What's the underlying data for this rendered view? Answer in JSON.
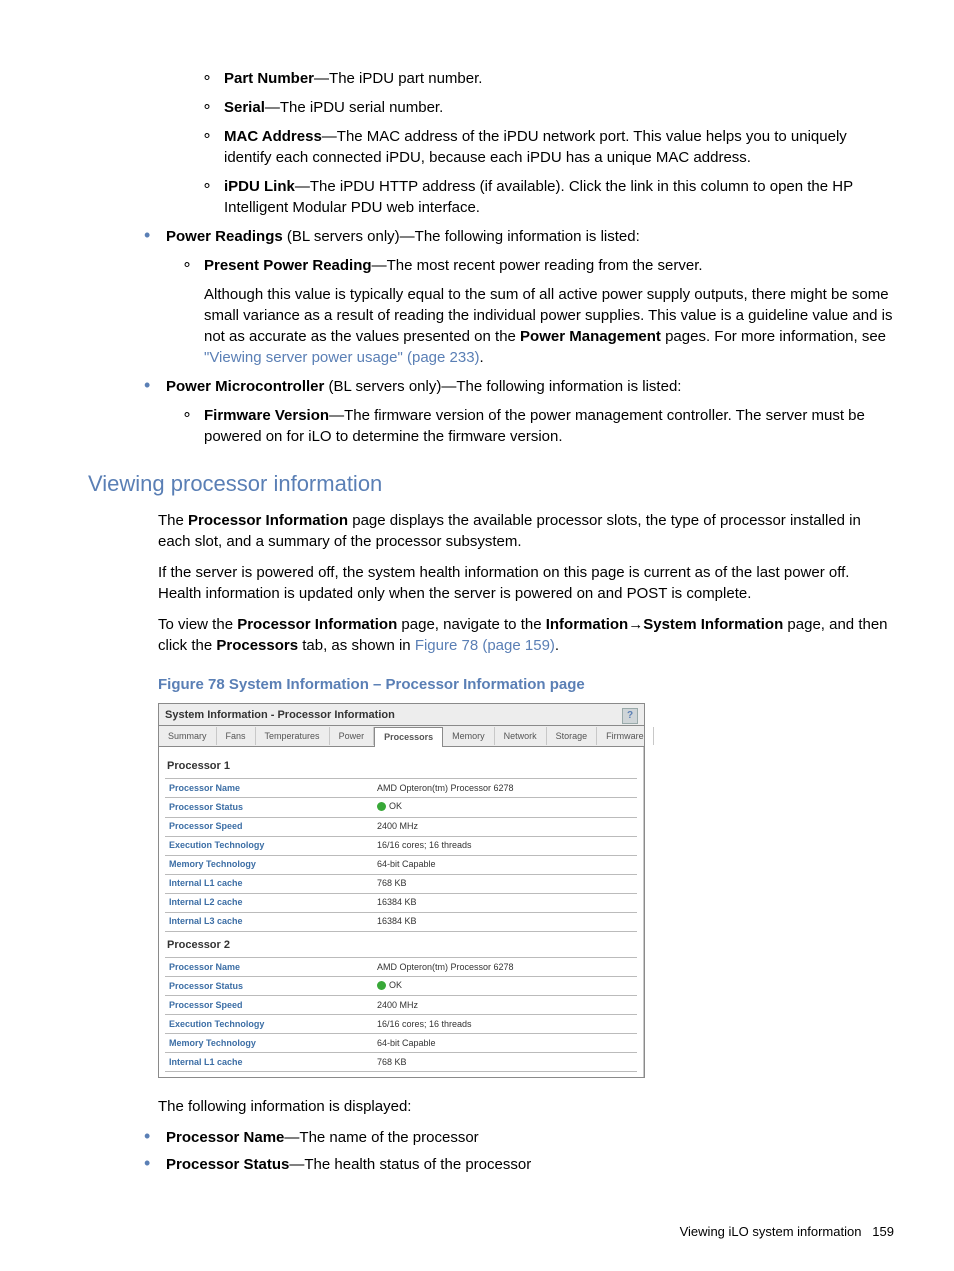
{
  "bullets_top": {
    "sub": [
      {
        "term": "Part Number",
        "desc": "—The iPDU part number."
      },
      {
        "term": "Serial",
        "desc": "—The iPDU serial number."
      },
      {
        "term": "MAC Address",
        "desc": "—The MAC address of the iPDU network port. This value helps you to uniquely identify each connected iPDU, because each iPDU has a unique MAC address."
      },
      {
        "term": "iPDU Link",
        "desc": "—The iPDU HTTP address (if available). Click the link in this column to open the HP Intelligent Modular PDU web interface."
      }
    ],
    "power_readings": {
      "term": "Power Readings",
      "suffix": " (BL servers only)—The following information is listed:",
      "sub": {
        "term": "Present Power Reading",
        "desc": "—The most recent power reading from the server.",
        "para_pre": "Although this value is typically equal to the sum of all active power supply outputs, there might be some small variance as a result of reading the individual power supplies. This value is a guideline value and is not as accurate as the values presented on the ",
        "para_bold": "Power Management",
        "para_mid": " pages. For more information, see ",
        "para_link": "\"Viewing server power usage\" (page 233)",
        "para_end": "."
      }
    },
    "power_micro": {
      "term": "Power Microcontroller",
      "suffix": " (BL servers only)—The following information is listed:",
      "sub": {
        "term": "Firmware Version",
        "desc": "—The firmware version of the power management controller. The server must be powered on for iLO to determine the firmware version."
      }
    }
  },
  "section_heading": "Viewing processor information",
  "para1_pre": "The ",
  "para1_bold": "Processor Information",
  "para1_post": " page displays the available processor slots, the type of processor installed in each slot, and a summary of the processor subsystem.",
  "para2": "If the server is powered off, the system health information on this page is current as of the last power off. Health information is updated only when the server is powered on and POST is complete.",
  "para3_pre": "To view the ",
  "para3_b1": "Processor Information",
  "para3_mid1": " page, navigate to the ",
  "para3_b2": "Information",
  "para3_arrow": "→",
  "para3_b3": "System Information",
  "para3_mid2": " page, and then click the ",
  "para3_b4": "Processors",
  "para3_mid3": " tab, as shown in ",
  "para3_link": "Figure 78 (page 159)",
  "para3_end": ".",
  "figure_caption": "Figure 78 System Information – Processor Information page",
  "shot": {
    "title": "System Information - Processor Information",
    "help": "?",
    "tabs": [
      "Summary",
      "Fans",
      "Temperatures",
      "Power",
      "Processors",
      "Memory",
      "Network",
      "Storage",
      "Firmware"
    ],
    "active_tab": "Processors",
    "processors": [
      {
        "heading": "Processor 1",
        "rows": [
          [
            "Processor Name",
            "AMD Opteron(tm) Processor 6278"
          ],
          [
            "Processor Status",
            "OK"
          ],
          [
            "Processor Speed",
            "2400 MHz"
          ],
          [
            "Execution Technology",
            "16/16 cores; 16 threads"
          ],
          [
            "Memory Technology",
            "64-bit Capable"
          ],
          [
            "Internal L1 cache",
            "768 KB"
          ],
          [
            "Internal L2 cache",
            "16384 KB"
          ],
          [
            "Internal L3 cache",
            "16384 KB"
          ]
        ]
      },
      {
        "heading": "Processor 2",
        "rows": [
          [
            "Processor Name",
            "AMD Opteron(tm) Processor 6278"
          ],
          [
            "Processor Status",
            "OK"
          ],
          [
            "Processor Speed",
            "2400 MHz"
          ],
          [
            "Execution Technology",
            "16/16 cores; 16 threads"
          ],
          [
            "Memory Technology",
            "64-bit Capable"
          ],
          [
            "Internal L1 cache",
            "768 KB"
          ],
          [
            "Internal L2 cache",
            "16384 KB"
          ]
        ]
      }
    ]
  },
  "post_para": "The following information is displayed:",
  "post_bullets": [
    {
      "term": "Processor Name",
      "desc": "—The name of the processor"
    },
    {
      "term": "Processor Status",
      "desc": "—The health status of the processor"
    }
  ],
  "footer_text": "Viewing iLO system information",
  "footer_page": "159"
}
